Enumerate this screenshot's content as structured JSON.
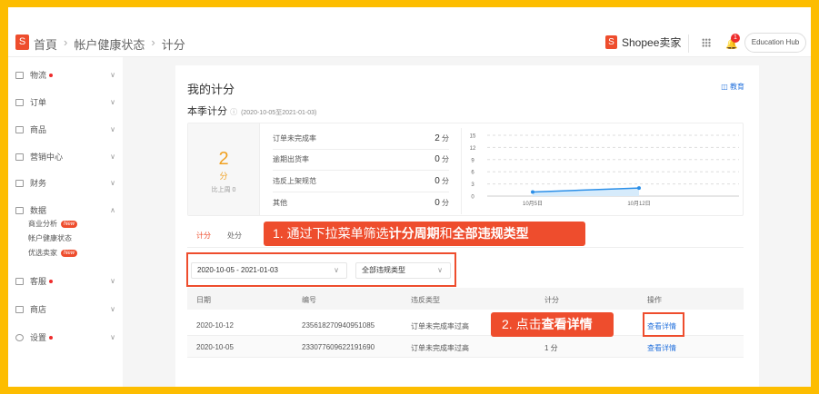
{
  "header": {
    "breadcrumb": [
      "首頁",
      "帐户健康状态",
      "计分"
    ],
    "brand": "Shopee卖家",
    "notification_count": "1",
    "education_hub": "Education Hub"
  },
  "sidebar": {
    "items": [
      {
        "label": "物流",
        "dot": true
      },
      {
        "label": "订单"
      },
      {
        "label": "商品"
      },
      {
        "label": "营销中心"
      },
      {
        "label": "财务"
      },
      {
        "label": "数据",
        "expanded": true
      },
      {
        "label": "客服",
        "dot": true
      },
      {
        "label": "商店"
      },
      {
        "label": "设置",
        "dot": true
      }
    ],
    "subitems": [
      {
        "label": "商业分析",
        "badge": "New"
      },
      {
        "label": "帐户健康状态"
      },
      {
        "label": "优选卖家",
        "badge": "New"
      }
    ]
  },
  "main": {
    "title": "我的计分",
    "edu_link": "教育",
    "season_title": "本季计分",
    "season_range": "(2020-10-05至2021-01-03)",
    "total_score": "2",
    "score_unit": "分",
    "compare": "比上周 0",
    "breakdown": [
      {
        "label": "订单未完成率",
        "value": "2",
        "unit": "分"
      },
      {
        "label": "逾期出货率",
        "value": "0",
        "unit": "分"
      },
      {
        "label": "违反上架规范",
        "value": "0",
        "unit": "分"
      },
      {
        "label": "其他",
        "value": "0",
        "unit": "分"
      }
    ],
    "tabs": [
      "计分",
      "处分"
    ],
    "filters": {
      "period": "2020-10-05 - 2021-01-03",
      "type": "全部违规类型"
    },
    "table": {
      "headers": [
        "日期",
        "编号",
        "违反类型",
        "计分",
        "操作"
      ],
      "rows": [
        {
          "date": "2020-10-12",
          "id": "235618270940951085",
          "type": "订单未完成率过高",
          "score": "",
          "action": "查看详情"
        },
        {
          "date": "2020-10-05",
          "id": "233077609622191690",
          "type": "订单未完成率过高",
          "score": "1 分",
          "action": "查看详情"
        }
      ]
    }
  },
  "annotations": {
    "step1_a": "1. 通过下拉菜单筛选",
    "step1_b": "计分周期",
    "step1_c": "和",
    "step1_d": "全部违规类型",
    "step2_a": "2. 点击",
    "step2_b": "查看详情"
  },
  "chart_data": {
    "type": "line",
    "categories": [
      "10月5日",
      "10月12日"
    ],
    "values": [
      1,
      2
    ],
    "yticks": [
      0,
      3,
      6,
      9,
      12,
      15
    ],
    "ylim": [
      0,
      15
    ],
    "grid": true,
    "color": "#2b8fe8"
  }
}
